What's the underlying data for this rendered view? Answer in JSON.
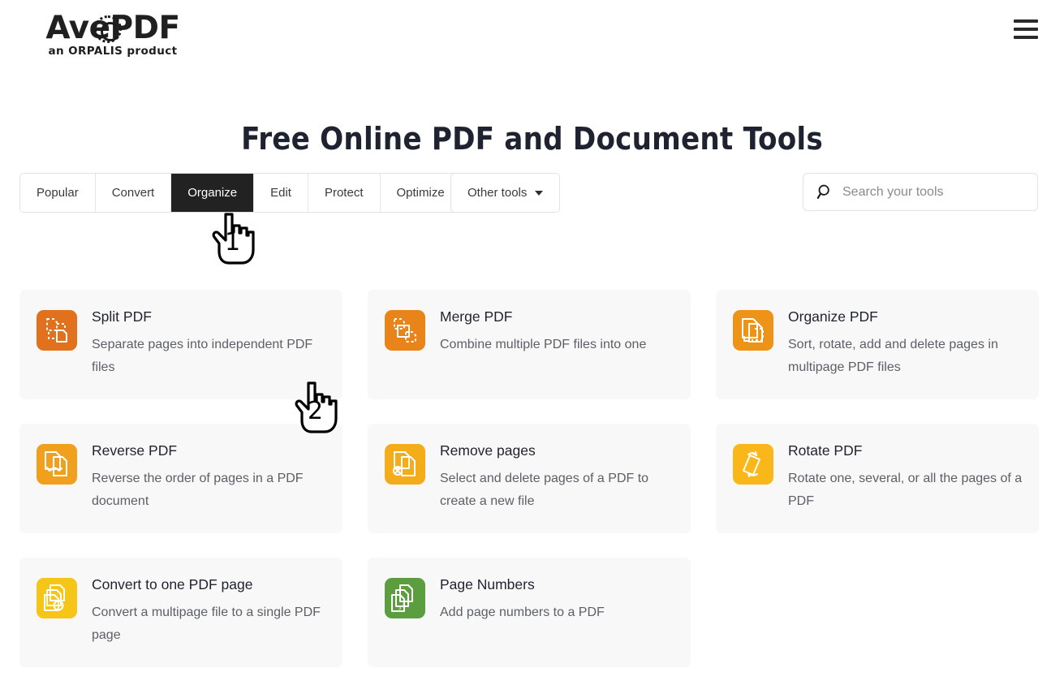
{
  "header": {
    "logo_main_a": "Av",
    "logo_main_b": "e",
    "logo_main_c": "PDF",
    "logo_sub": "an ORPALIS product",
    "menu_icon": "hamburger-menu-icon"
  },
  "page_title": "Free Online PDF and Document Tools",
  "tabs": [
    {
      "label": "Popular",
      "active": false
    },
    {
      "label": "Convert",
      "active": false
    },
    {
      "label": "Organize",
      "active": true
    },
    {
      "label": "Edit",
      "active": false
    },
    {
      "label": "Protect",
      "active": false
    },
    {
      "label": "Optimize",
      "active": false
    }
  ],
  "other_tools": {
    "label": "Other tools",
    "icon": "chevron-down-icon"
  },
  "search": {
    "placeholder": "Search your tools",
    "value": "",
    "icon": "search-icon"
  },
  "colors": {
    "accent_orange_dark": "#E2711D",
    "accent_orange": "#ED8B16",
    "accent_amber": "#F5A623",
    "accent_yellow": "#F5BE18",
    "accent_green": "#5C9E3F",
    "active_tab_bg": "#222222",
    "card_bg": "#F8F8F8",
    "title_color": "#1F2330",
    "desc_color": "#5C6066"
  },
  "tools": [
    {
      "title": "Split PDF",
      "description": "Separate pages into independent PDF files",
      "icon": "split-pdf-icon",
      "icon_color": "#E2711D"
    },
    {
      "title": "Merge PDF",
      "description": "Combine multiple PDF files into one",
      "icon": "merge-pdf-icon",
      "icon_color": "#E8841A"
    },
    {
      "title": "Organize PDF",
      "description": "Sort, rotate, add and delete pages in multipage PDF files",
      "icon": "organize-pdf-icon",
      "icon_color": "#ED9418"
    },
    {
      "title": "Reverse PDF",
      "description": "Reverse the order of pages in a PDF document",
      "icon": "reverse-pdf-icon",
      "icon_color": "#F0A01C"
    },
    {
      "title": "Remove pages",
      "description": "Select and delete pages of a PDF to create a new file",
      "icon": "remove-pages-icon",
      "icon_color": "#F5AC1B"
    },
    {
      "title": "Rotate PDF",
      "description": "Rotate one, several, or all the pages of a PDF",
      "icon": "rotate-pdf-icon",
      "icon_color": "#F9B719"
    },
    {
      "title": "Convert to one PDF page",
      "description": "Convert a multipage file to a single PDF page",
      "icon": "convert-to-one-page-icon",
      "icon_color": "#F5C518"
    },
    {
      "title": "Page Numbers",
      "description": "Add page numbers to a PDF",
      "icon": "page-numbers-icon",
      "icon_color": "#5C9E3F"
    }
  ],
  "cursors": [
    {
      "label": "1",
      "name": "pointer-cursor-step-1"
    },
    {
      "label": "2",
      "name": "pointer-cursor-step-2"
    }
  ]
}
